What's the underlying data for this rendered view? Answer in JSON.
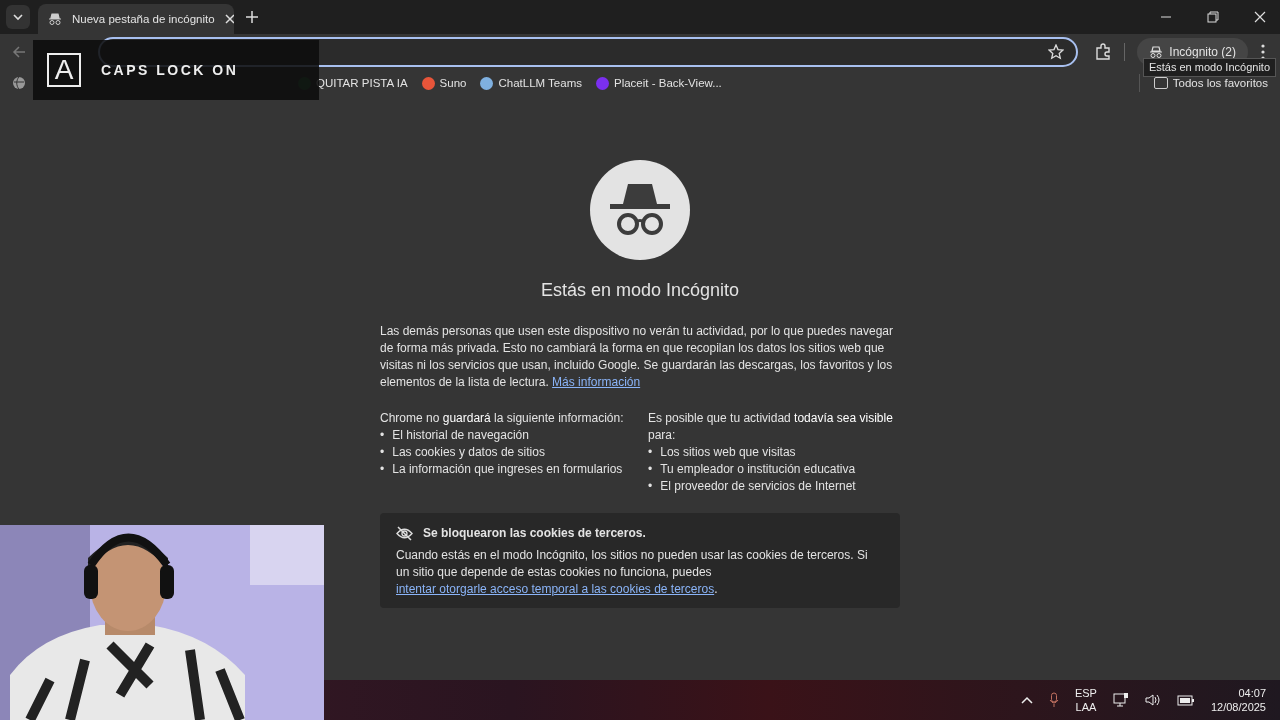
{
  "tabs": [
    {
      "title": "Nueva pestaña de incógnito",
      "selected": true
    }
  ],
  "toolbar": {
    "profile_button": "Incógnito (2)",
    "tooltip": "Estás en modo Incógnito"
  },
  "bookmarks": [
    {
      "label": "QUITAR PISTA IA"
    },
    {
      "label": "Suno"
    },
    {
      "label": "ChatLLM Teams"
    },
    {
      "label": "Placeit - Back-View..."
    }
  ],
  "all_bookmarks": "Todos los favoritos",
  "caps_overlay": {
    "key": "A",
    "text": "CAPS LOCK ON"
  },
  "page": {
    "heading": "Estás en modo Incógnito",
    "intro": "Las demás personas que usen este dispositivo no verán tu actividad, por lo que puedes navegar de forma más privada. Esto no cambiará la forma en que recopilan los datos los sitios web que visitas ni los servicios que usan, incluido Google. Se guardarán las descargas, los favoritos y los elementos de la lista de lectura.",
    "intro_link": "Más información",
    "columns": [
      {
        "title": "Chrome no **guardará** la siguiente información:",
        "bullet": "•",
        "items": [
          "El historial de navegación",
          "Las cookies y datos de sitios",
          "La información que ingreses en formularios"
        ]
      },
      {
        "title": "Es posible que tu actividad **todavía sea visible** para:",
        "bullet": "•",
        "items": [
          "Los sitios web que visitas",
          "Tu empleador o institución educativa",
          "El proveedor de servicios de Internet"
        ]
      }
    ],
    "cookie_card": {
      "title": "Se bloquearon las cookies de terceros.",
      "text": "Cuando estás en el modo Incógnito, los sitios no pueden usar las cookies de terceros. Si un sitio que depende de estas cookies no funciona, puedes",
      "link": "intentar otorgarle acceso temporal a las cookies de terceros",
      "end": "."
    }
  },
  "taskbar": {
    "language": "ESP",
    "layout": "LAA",
    "time": "04:07",
    "date": "12/08/2025"
  }
}
